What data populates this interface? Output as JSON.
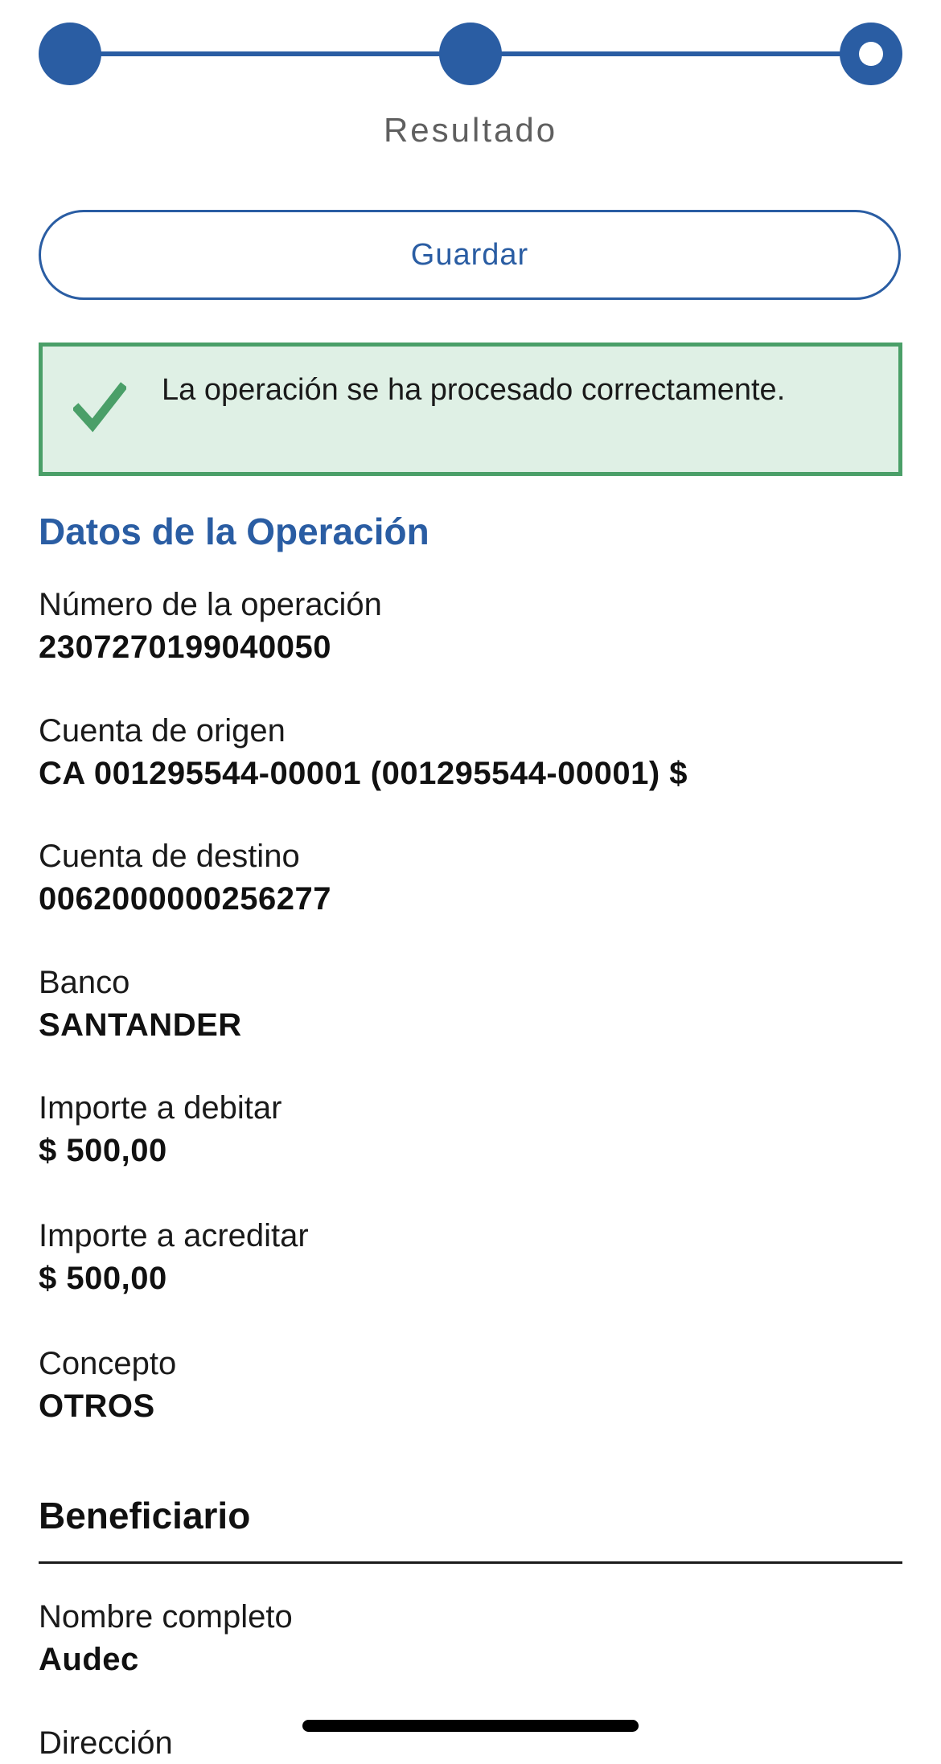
{
  "stepper": {
    "steps": 3,
    "current_step": 3,
    "current_label": "Resultado"
  },
  "actions": {
    "save_label": "Guardar"
  },
  "alert": {
    "type": "success",
    "icon": "check-icon",
    "message": "La operación se ha procesado correctamente."
  },
  "operation": {
    "title": "Datos de la Operación",
    "fields": [
      {
        "label": "Número de la operación",
        "value": "2307270199040050"
      },
      {
        "label": "Cuenta de origen",
        "value": "CA 001295544-00001 (001295544-00001) $"
      },
      {
        "label": "Cuenta de destino",
        "value": "0062000000256277"
      },
      {
        "label": "Banco",
        "value": "SANTANDER"
      },
      {
        "label": "Importe a debitar",
        "value": "$ 500,00"
      },
      {
        "label": "Importe a acreditar",
        "value": "$ 500,00"
      },
      {
        "label": "Concepto",
        "value": "OTROS"
      }
    ]
  },
  "beneficiary": {
    "title": "Beneficiario",
    "fields": [
      {
        "label": "Nombre completo",
        "value": "Audec"
      },
      {
        "label": "Dirección",
        "value": ""
      }
    ]
  },
  "colors": {
    "primary": "#2a5da3",
    "success_border": "#4a9f68",
    "success_bg": "#dff0e5"
  }
}
